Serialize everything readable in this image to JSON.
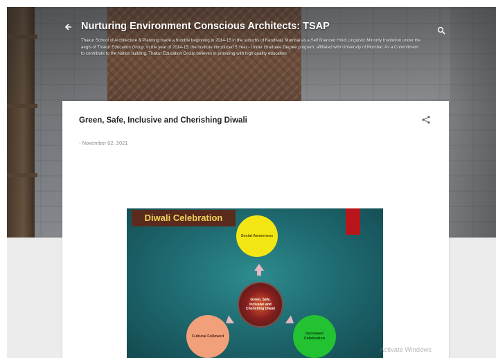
{
  "header": {
    "back_icon": "arrow-left-icon",
    "title": "Nurturing Environment Conscious Architects: TSAP",
    "description": "Thakur School of Architecture & Planning made a humble beginning in 2014-15 in the suburbs of Kandivali, Mumbai as a Self financed Hindi Linguistic Minority Institution under the aegis of Thakur Education Group. In the year of 2014-15, the institute introduced 5 Year - Under Graduate Degree program, affiliated with University of Mumbai. As a Commitment to contribute to the Nation building, Thakur Education Group believes in providing with high quality education",
    "search_icon": "search-icon"
  },
  "post": {
    "title": "Green, Safe, Inclusive and Cherishing Diwali",
    "date": "- November 02, 2021",
    "share_icon": "share-icon"
  },
  "slide": {
    "banner": "Diwali Celebration",
    "top": "Social Awareness",
    "center": "Green, Safe, Inclusive and Cherishing Diwali",
    "left": "Cultural Followed",
    "right": "Increased Celebration",
    "colors": {
      "background": "#1f6c72",
      "banner": "#5a2b1c",
      "banner_text": "#f2d45c",
      "top_bubble": "#f3e614",
      "left_bubble": "#f2a07a",
      "right_bubble": "#22c232"
    }
  },
  "watermark": "Activate Windows"
}
